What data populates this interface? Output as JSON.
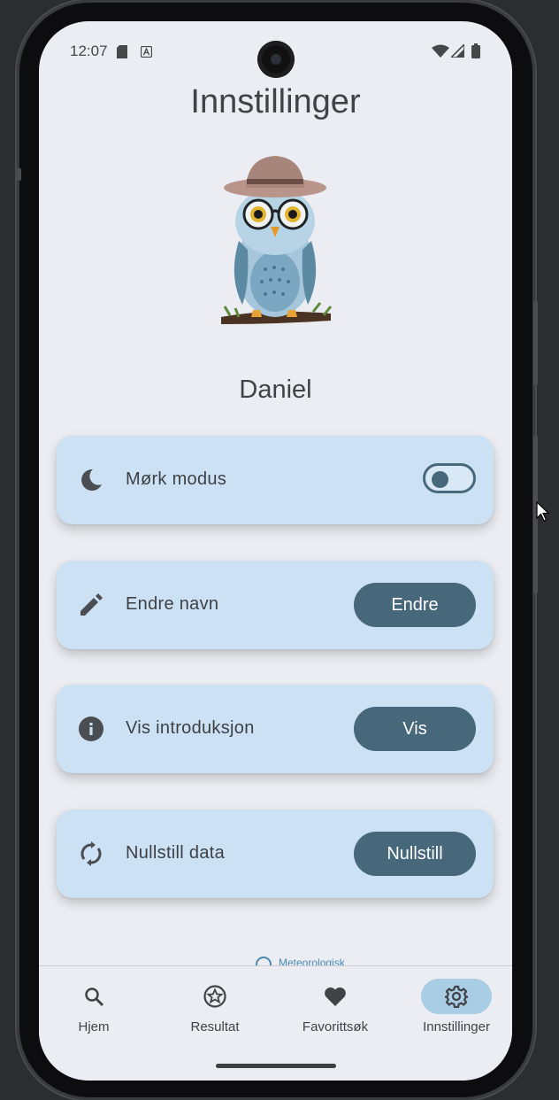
{
  "status_bar": {
    "time": "12:07"
  },
  "page": {
    "title": "Innstillinger",
    "user_name": "Daniel"
  },
  "settings": [
    {
      "label": "Mørk modus",
      "icon": "moon-icon",
      "control": "toggle",
      "toggle_on": false
    },
    {
      "label": "Endre navn",
      "icon": "pencil-icon",
      "control": "button",
      "button_label": "Endre"
    },
    {
      "label": "Vis introduksjon",
      "icon": "info-icon",
      "control": "button",
      "button_label": "Vis"
    },
    {
      "label": "Nullstill data",
      "icon": "refresh-icon",
      "control": "button",
      "button_label": "Nullstill"
    }
  ],
  "credit_text": "Meteorologisk",
  "nav": {
    "items": [
      {
        "label": "Hjem",
        "icon": "search-icon",
        "active": false
      },
      {
        "label": "Resultat",
        "icon": "star-badge-icon",
        "active": false
      },
      {
        "label": "Favorittsøk",
        "icon": "heart-icon",
        "active": false
      },
      {
        "label": "Innstillinger",
        "icon": "gear-icon",
        "active": true
      }
    ]
  },
  "colors": {
    "background": "#ebedf2",
    "card": "#cce2f4",
    "button": "#47677a",
    "nav_active": "#a9cde4",
    "text": "#404246"
  }
}
